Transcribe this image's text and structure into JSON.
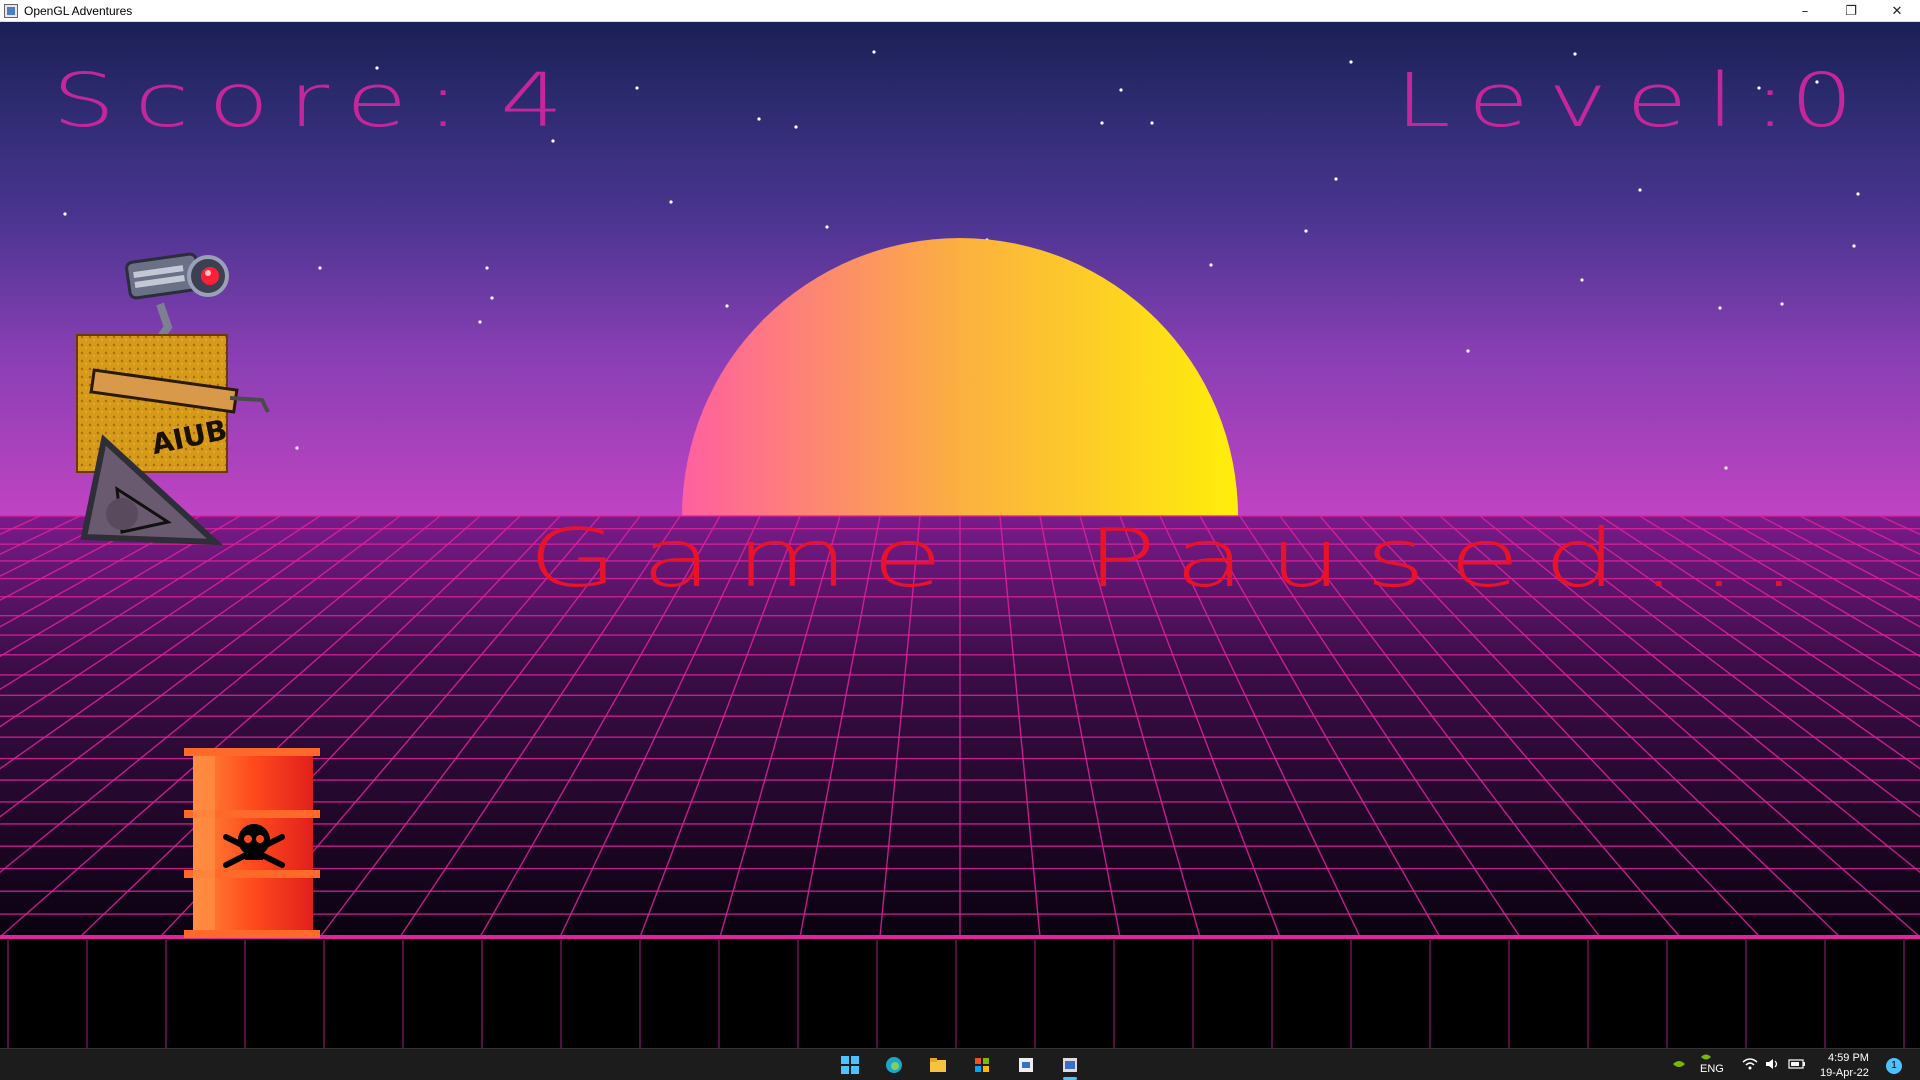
{
  "window": {
    "title": "OpenGL Adventures",
    "controls": {
      "minimize": "–",
      "restore": "❐",
      "close": "✕"
    }
  },
  "hud": {
    "score_label": "Score:",
    "score_value": "4",
    "level_label": "Level:",
    "level_value": "0",
    "color": "#c4279b"
  },
  "overlay": {
    "paused_text": "Game  Paused...",
    "color": "#e8132a"
  },
  "scene": {
    "sun_colors": [
      "#ff5fa0",
      "#fbb040",
      "#ffee0a"
    ],
    "grid_color": "#e0229c",
    "crate_label": "AIUB",
    "barrel_color": "#ff4a1c"
  },
  "taskbar": {
    "icons": [
      "windows-start-icon",
      "edge-icon",
      "file-explorer-icon",
      "store-icon",
      "app-icon",
      "opengl-app-icon"
    ],
    "tray": {
      "language": "ENG",
      "time": "4:59 PM",
      "date": "19-Apr-22",
      "notification_count": "1"
    }
  }
}
